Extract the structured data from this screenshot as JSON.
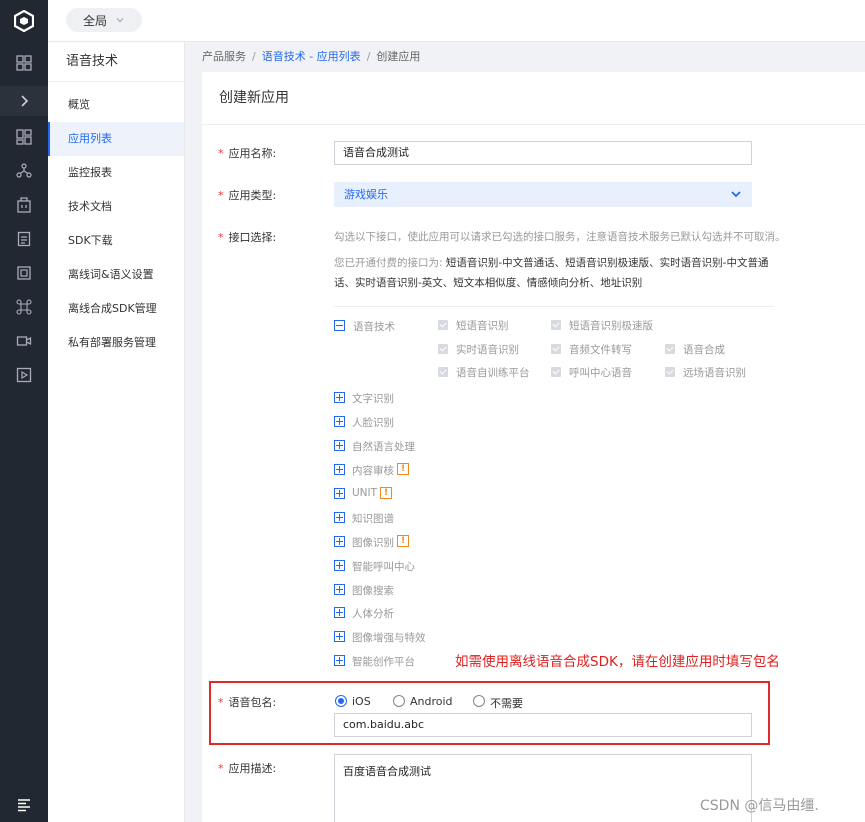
{
  "topbar": {
    "scope_label": "全局"
  },
  "sidenav": {
    "title": "语音技术",
    "items": [
      {
        "label": "概览"
      },
      {
        "label": "应用列表"
      },
      {
        "label": "监控报表"
      },
      {
        "label": "技术文档"
      },
      {
        "label": "SDK下载"
      },
      {
        "label": "离线词&语义设置"
      },
      {
        "label": "离线合成SDK管理"
      },
      {
        "label": "私有部署服务管理"
      }
    ]
  },
  "breadcrumb": {
    "root": "产品服务",
    "parent": "语音技术 - 应用列表",
    "current": "创建应用"
  },
  "card_title": "创建新应用",
  "form": {
    "name_label": "应用名称:",
    "name_value": "语音合成测试",
    "type_label": "应用类型:",
    "type_value": "游戏娱乐",
    "api_label": "接口选择:",
    "api_hint": "勾选以下接口，使此应用可以请求已勾选的接口服务，注意语音技术服务已默认勾选并不可取消。",
    "paid_prefix": "您已开通付费的接口为:",
    "paid_line1": "短语音识别-中文普通话、短语音识别极速版、实时语音识别-中文普通",
    "paid_line2": "话、实时语音识别-英文、短文本相似度、情感倾向分析、地址识别",
    "speech_group": "语音技术",
    "speech_items": [
      "短语音识别",
      "短语音识别极速版",
      "实时语音识别",
      "音频文件转写",
      "语音合成",
      "语音自训练平台",
      "呼叫中心语音",
      "远场语音识别"
    ],
    "other_groups": [
      "文字识别",
      "人脸识别",
      "自然语言处理",
      "内容审核",
      "UNIT",
      "知识图谱",
      "图像识别",
      "智能呼叫中心",
      "图像搜索",
      "人体分析",
      "图像增强与特效",
      "智能创作平台"
    ],
    "warn_mark": "!",
    "annotation": "如需使用离线语音合成SDK，请在创建应用时填写包名",
    "package_label": "语音包名:",
    "package_options": [
      "iOS",
      "Android",
      "不需要"
    ],
    "package_selected": "iOS",
    "package_value": "com.baidu.abc",
    "desc_label": "应用描述:",
    "desc_value": "百度语音合成测试"
  },
  "watermark": "CSDN @信马由缰.",
  "colors": {
    "accent": "#2468f2",
    "annotation": "#e0201f",
    "rail": "#222831"
  }
}
